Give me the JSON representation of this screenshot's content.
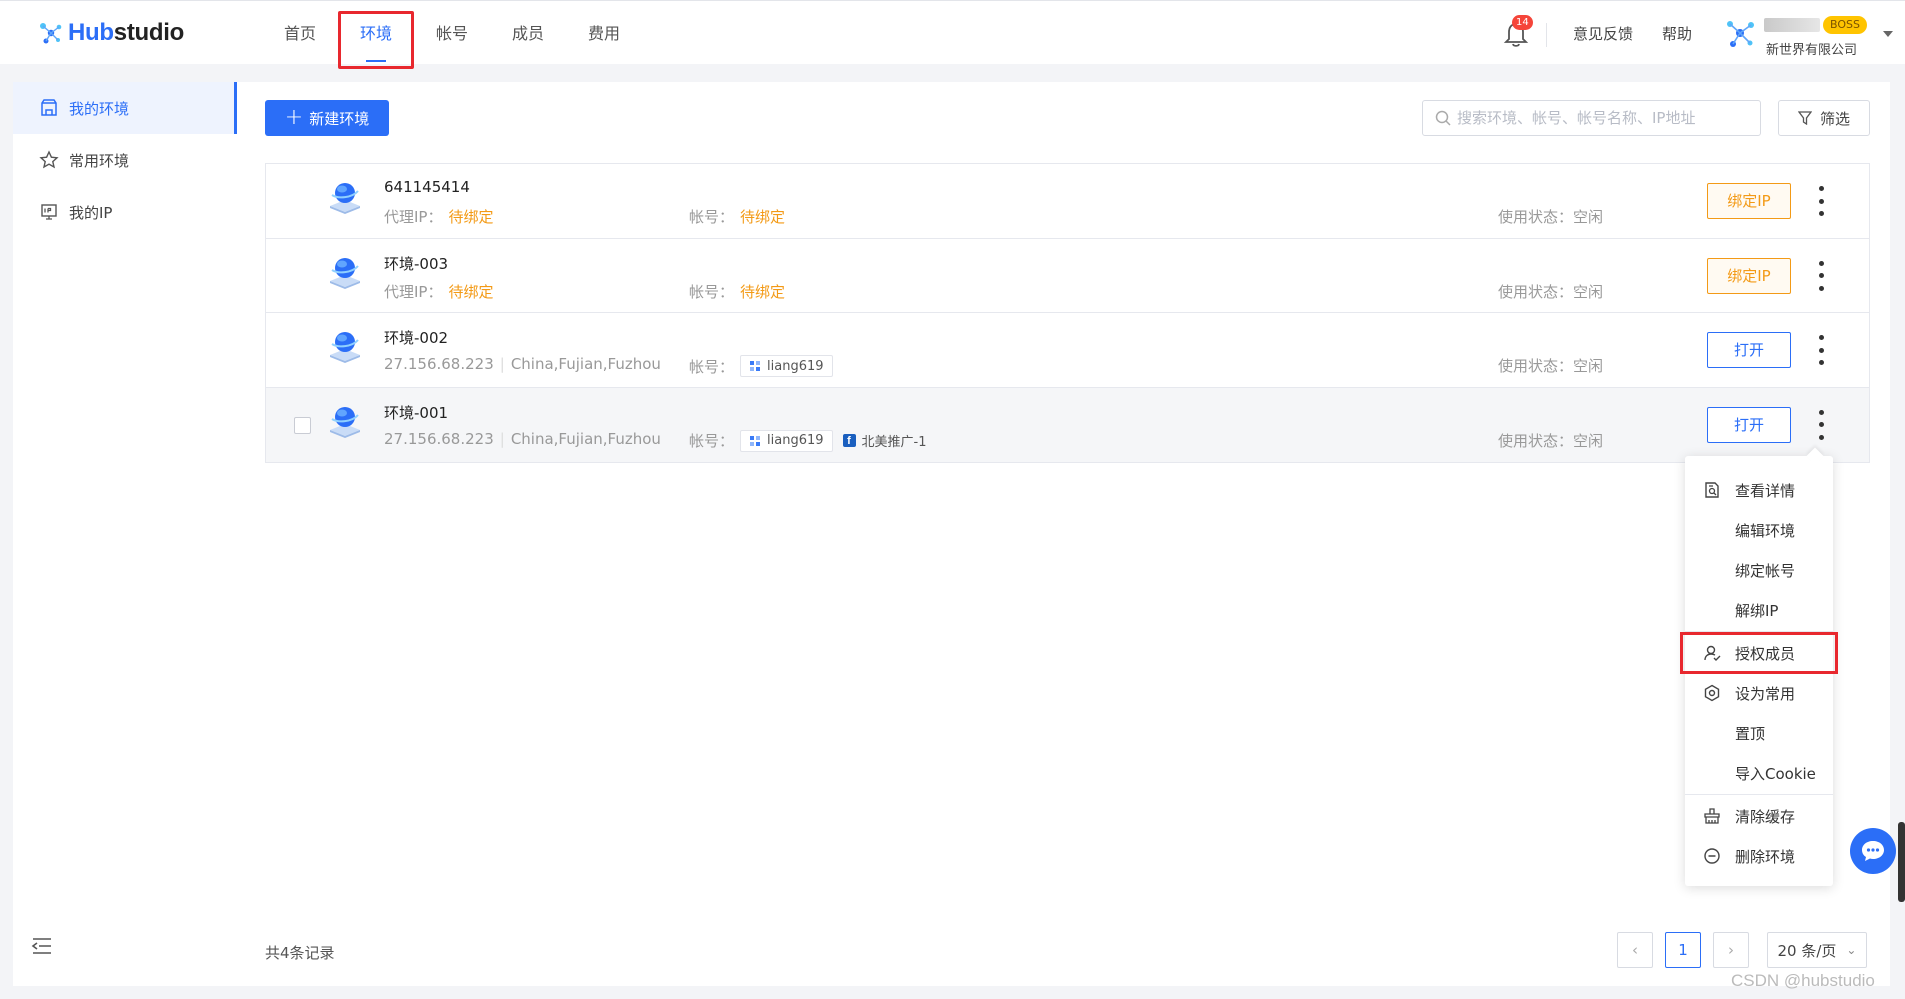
{
  "header": {
    "logo_text_hub": "Hub",
    "logo_text_studio": "studio",
    "nav": [
      "首页",
      "环境",
      "帐号",
      "成员",
      "费用"
    ],
    "active_nav": 1,
    "notification_count": "14",
    "feedback": "意见反馈",
    "help": "帮助",
    "boss_badge": "BOSS",
    "company": "新世界有限公司"
  },
  "sidebar": {
    "items": [
      {
        "label": "我的环境",
        "icon": "store-icon",
        "active": true
      },
      {
        "label": "常用环境",
        "icon": "star-icon",
        "active": false
      },
      {
        "label": "我的IP",
        "icon": "ip-icon",
        "active": false
      }
    ]
  },
  "toolbar": {
    "new_label": "新建环境",
    "search_placeholder": "搜索环境、帐号、帐号名称、IP地址",
    "filter_label": "筛选"
  },
  "labels": {
    "proxy_ip": "代理IP：",
    "account": "帐号：",
    "use_state": "使用状态：",
    "idle": "空闲"
  },
  "rows": [
    {
      "name": "641145414",
      "proxy": "待绑定",
      "proxy_pending": true,
      "location": "",
      "account": "待绑定",
      "account_pending": true,
      "tags": [],
      "state": "空闲",
      "action": "绑定IP",
      "action_style": "orange"
    },
    {
      "name": "环境-003",
      "proxy": "待绑定",
      "proxy_pending": true,
      "location": "",
      "account": "待绑定",
      "account_pending": true,
      "tags": [],
      "state": "空闲",
      "action": "绑定IP",
      "action_style": "orange"
    },
    {
      "name": "环境-002",
      "proxy": "27.156.68.223",
      "proxy_pending": false,
      "location": "China,Fujian,Fuzhou",
      "account": "",
      "account_pending": false,
      "tags": [
        {
          "icon": "grid-icon",
          "text": "liang619"
        }
      ],
      "state": "空闲",
      "action": "打开",
      "action_style": "blue"
    },
    {
      "name": "环境-001",
      "proxy": "27.156.68.223",
      "proxy_pending": false,
      "location": "China,Fujian,Fuzhou",
      "account": "",
      "account_pending": false,
      "tags": [
        {
          "icon": "grid-icon",
          "text": "liang619"
        },
        {
          "icon": "facebook-icon",
          "text": "北美推广-1"
        }
      ],
      "state": "空闲",
      "action": "打开",
      "action_style": "blue"
    }
  ],
  "footer": {
    "total": "共4条记录",
    "current_page": "1",
    "page_size": "20 条/页"
  },
  "menu": {
    "items": [
      {
        "label": "查看详情",
        "icon": "detail-icon"
      },
      {
        "label": "编辑环境",
        "icon": ""
      },
      {
        "label": "绑定帐号",
        "icon": ""
      },
      {
        "label": "解绑IP",
        "icon": ""
      },
      {
        "label": "授权成员",
        "icon": "user-auth-icon",
        "highlight": true
      },
      {
        "label": "设为常用",
        "icon": "settings-icon"
      },
      {
        "label": "置顶",
        "icon": ""
      },
      {
        "label": "导入Cookie",
        "icon": ""
      },
      {
        "label": "清除缓存",
        "icon": "broom-icon"
      },
      {
        "label": "删除环境",
        "icon": "minus-circle-icon"
      }
    ]
  },
  "watermark": "CSDN @hubstudio",
  "colors": {
    "primary": "#2b6ef7",
    "warning": "#f39a16",
    "highlight_box": "#e8282e"
  }
}
